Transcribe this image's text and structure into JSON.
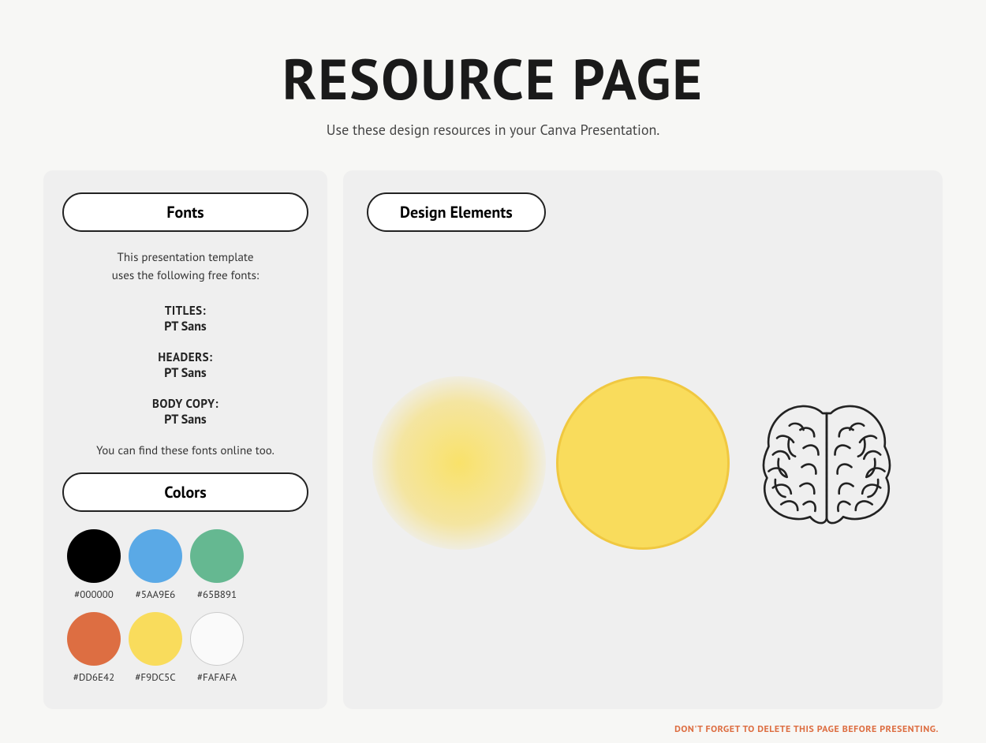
{
  "header": {
    "title": "RESOURCE PAGE",
    "subtitle": "Use these design resources in your Canva Presentation."
  },
  "fonts_panel": {
    "section_label": "Fonts",
    "description_line1": "This presentation template",
    "description_line2": "uses the following free fonts:",
    "fonts": [
      {
        "label": "TITLES:",
        "name": "PT Sans"
      },
      {
        "label": "HEADERS:",
        "name": "PT Sans"
      },
      {
        "label": "BODY COPY:",
        "name": "PT Sans"
      }
    ],
    "find_fonts_text": "You can find these fonts online too.",
    "colors_label": "Colors",
    "colors": [
      {
        "hex": "#000000",
        "label": "#000000"
      },
      {
        "hex": "#5AA9E6",
        "label": "#5AA9E6"
      },
      {
        "hex": "#65B891",
        "label": "#65B891"
      },
      {
        "hex": "#DD6E42",
        "label": "#DD6E42"
      },
      {
        "hex": "#F9DC5C",
        "label": "#F9DC5C"
      },
      {
        "hex": "#FAFAFA",
        "label": "#FAFAFA"
      }
    ]
  },
  "design_elements_panel": {
    "section_label": "Design Elements"
  },
  "footer": {
    "note": "DON'T FORGET TO DELETE THIS PAGE BEFORE PRESENTING."
  }
}
